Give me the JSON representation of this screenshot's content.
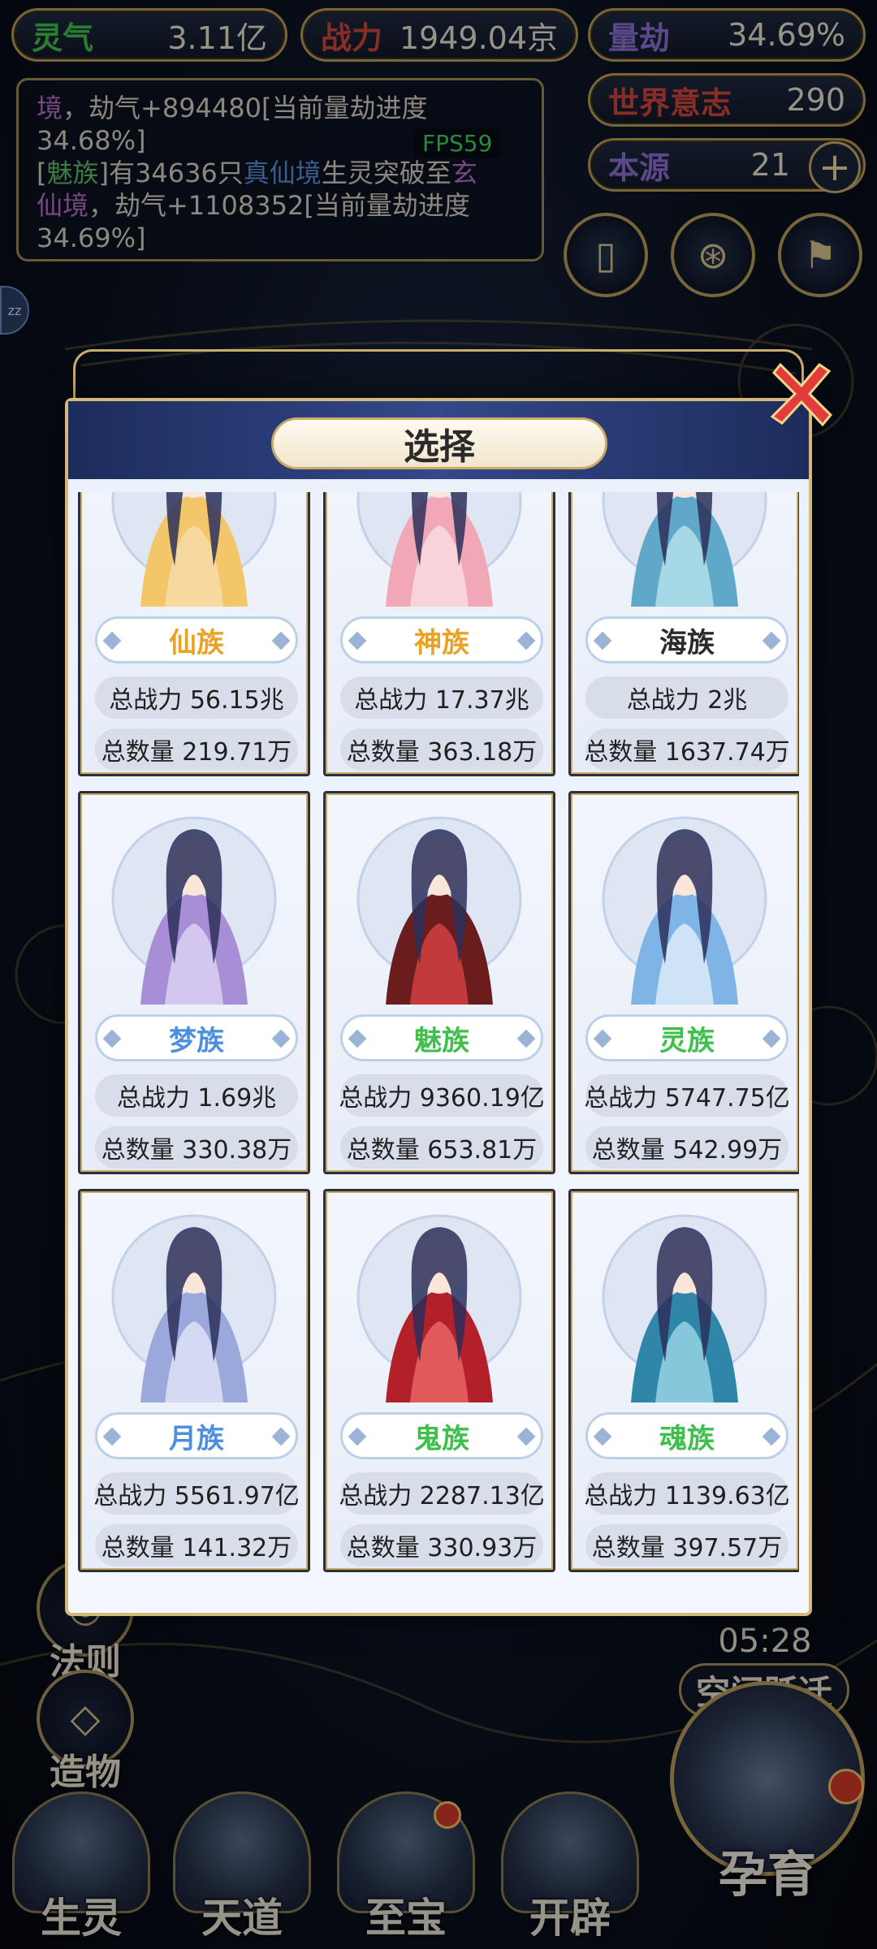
{
  "top_stats": {
    "lingqi": {
      "label": "灵气",
      "value": "3.11亿"
    },
    "zhanli": {
      "label": "战力",
      "value": "1949.04京"
    },
    "liangjie": {
      "label": "量劫",
      "value": "34.69%"
    },
    "world_will": {
      "label": "世界意志",
      "value": "290"
    },
    "origin": {
      "label": "本源",
      "value": "21"
    }
  },
  "log": {
    "line1_realm": "境",
    "line1_text": "，劫气+894480[当前量劫进度",
    "line2_text": "34.68%]",
    "line3_open": "[",
    "line3_race": "魅族",
    "line3_mid": "]有34636只",
    "line3_realm": "真仙境",
    "line3_tail": "生灵突破至",
    "line3_realm2": "玄",
    "line4_realm2": "仙境",
    "line4_text": "，劫气+1108352[当前量劫进度",
    "line5_text": "34.69%]"
  },
  "fps": "FPS59",
  "side_tag": "zz",
  "modal": {
    "title": "选择",
    "cards": [
      {
        "race": "仙族",
        "race_color": "#e8a326",
        "power": "总战力 56.15兆",
        "count": "总数量 219.71万"
      },
      {
        "race": "神族",
        "race_color": "#e8a326",
        "power": "总战力 17.37兆",
        "count": "总数量 363.18万"
      },
      {
        "race": "海族",
        "race_color": "#2a2a2a",
        "power": "总战力 2兆",
        "count": "总数量 1637.74万"
      },
      {
        "race": "梦族",
        "race_color": "#4b8fe0",
        "power": "总战力 1.69兆",
        "count": "总数量 330.38万"
      },
      {
        "race": "魅族",
        "race_color": "#3fbf4c",
        "power": "总战力 9360.19亿",
        "count": "总数量 653.81万"
      },
      {
        "race": "灵族",
        "race_color": "#3fbf4c",
        "power": "总战力 5747.75亿",
        "count": "总数量 542.99万"
      },
      {
        "race": "月族",
        "race_color": "#4b8fe0",
        "power": "总战力 5561.97亿",
        "count": "总数量 141.32万"
      },
      {
        "race": "鬼族",
        "race_color": "#3fbf4c",
        "power": "总战力 2287.13亿",
        "count": "总数量 330.93万"
      },
      {
        "race": "魂族",
        "race_color": "#3fbf4c",
        "power": "总战力 1139.63亿",
        "count": "总数量 397.57万"
      }
    ]
  },
  "side_buttons": {
    "law": "法则",
    "creation": "造物"
  },
  "space_jump": {
    "timer": "05:28",
    "label": "空间跃迁"
  },
  "bottom_nav": [
    "生灵",
    "天道",
    "至宝",
    "开辟"
  ],
  "big_button": "孕育",
  "colors": {
    "gold": "#b99b5a",
    "navy": "#1c2c5c",
    "lingqi_label": "#3fbf4c",
    "zhanli_label": "#d0453a",
    "liangjie_label": "#8d6fd1",
    "world_label": "#d0453a",
    "origin_label": "#8d6fd1"
  },
  "icons": [
    "card-icon",
    "swirl-icon",
    "flag-icon",
    "close-icon",
    "plus-icon"
  ]
}
